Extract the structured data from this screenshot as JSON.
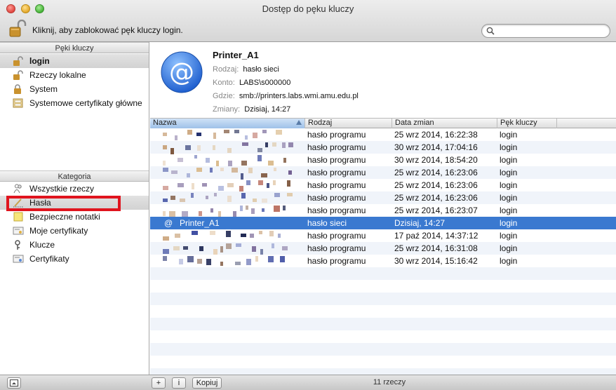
{
  "window": {
    "title": "Dostęp do pęku kluczy"
  },
  "toolbar": {
    "lock_text": "Kliknij, aby zablokować pęk kluczy login.",
    "search_placeholder": ""
  },
  "keychains": {
    "header": "Pęki kluczy",
    "items": [
      {
        "label": "login",
        "icon": "open-lock-icon",
        "selected": true
      },
      {
        "label": "Rzeczy lokalne",
        "icon": "open-lock-icon"
      },
      {
        "label": "System",
        "icon": "lock-icon"
      },
      {
        "label": "Systemowe certyfikaty główne",
        "icon": "certificate-cabinet-icon"
      }
    ]
  },
  "categories": {
    "header": "Kategoria",
    "items": [
      {
        "label": "Wszystkie rzeczy",
        "icon": "people-icon"
      },
      {
        "label": "Hasła",
        "icon": "pen-icon",
        "selected": true
      },
      {
        "label": "Bezpieczne notatki",
        "icon": "note-icon"
      },
      {
        "label": "Moje certyfikaty",
        "icon": "certificate-icon"
      },
      {
        "label": "Klucze",
        "icon": "key-icon"
      },
      {
        "label": "Certyfikaty",
        "icon": "certificate-icon"
      }
    ]
  },
  "details": {
    "title": "Printer_A1",
    "rows": [
      {
        "key": "Rodzaj:",
        "value": "hasło sieci"
      },
      {
        "key": "Konto:",
        "value": "LABS\\s000000"
      },
      {
        "key": "Gdzie:",
        "value": "smb://printers.labs.wmi.amu.edu.pl"
      },
      {
        "key": "Zmiany:",
        "value": "Dzisiaj, 14:27"
      }
    ]
  },
  "table": {
    "columns": [
      "Nazwa",
      "Rodzaj",
      "Data zmian",
      "Pęk kluczy"
    ],
    "rows": [
      {
        "name": "",
        "kind": "hasło programu",
        "date": "25 wrz 2014, 16:22:38",
        "keychain": "login"
      },
      {
        "name": "",
        "kind": "hasło programu",
        "date": "30 wrz 2014, 17:04:16",
        "keychain": "login"
      },
      {
        "name": "",
        "kind": "hasło programu",
        "date": "30 wrz 2014, 18:54:20",
        "keychain": "login"
      },
      {
        "name": "",
        "kind": "hasło programu",
        "date": "25 wrz 2014, 16:23:06",
        "keychain": "login"
      },
      {
        "name": "",
        "kind": "hasło programu",
        "date": "25 wrz 2014, 16:23:06",
        "keychain": "login"
      },
      {
        "name": "",
        "kind": "hasło programu",
        "date": "25 wrz 2014, 16:23:06",
        "keychain": "login"
      },
      {
        "name": "",
        "kind": "hasło programu",
        "date": "25 wrz 2014, 16:23:07",
        "keychain": "login"
      },
      {
        "name": "Printer_A1",
        "kind": "hasło sieci",
        "date": "Dzisiaj, 14:27",
        "keychain": "login",
        "selected": true
      },
      {
        "name": "",
        "kind": "hasło programu",
        "date": "17 paź 2014, 14:37:12",
        "keychain": "login"
      },
      {
        "name": "",
        "kind": "hasło programu",
        "date": "25 wrz 2014, 16:31:08",
        "keychain": "login"
      },
      {
        "name": "",
        "kind": "hasło programu",
        "date": "30 wrz 2014, 15:16:42",
        "keychain": "login"
      }
    ]
  },
  "bottombar": {
    "add_label": "+",
    "info_label": "i",
    "copy_label": "Kopiuj",
    "count": "11 rzeczy"
  },
  "colors": {
    "selection": "#3a79d0",
    "highlight_box": "#e0141e",
    "accent_blue": "#2a6fe0"
  }
}
